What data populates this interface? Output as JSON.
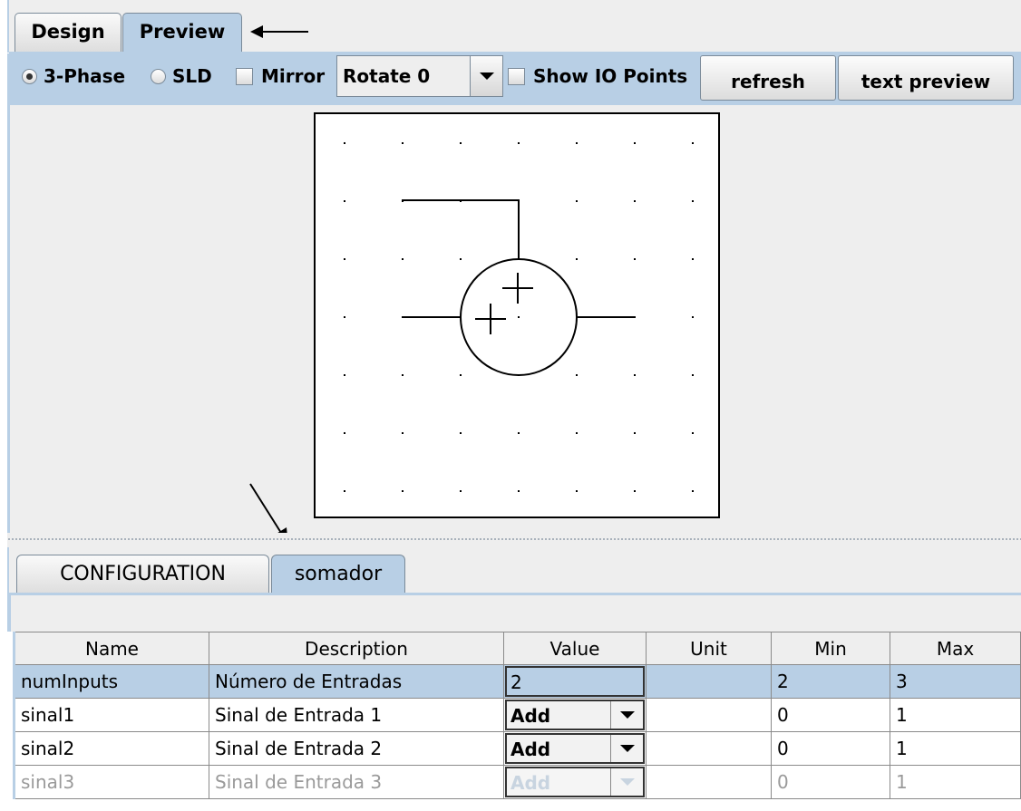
{
  "tabs": {
    "design": "Design",
    "preview": "Preview"
  },
  "toolbar": {
    "three_phase": "3-Phase",
    "sld": "SLD",
    "mirror": "Mirror",
    "rotate_value": "Rotate  0",
    "show_io": "Show IO Points",
    "refresh": "refresh",
    "text_preview": "text preview",
    "selected_mode": "3-Phase"
  },
  "symbol": {
    "grid": "7x7 dotted",
    "sign_top": "+",
    "sign_left": "+"
  },
  "bottom_tabs": {
    "configuration": "CONFIGURATION",
    "somador": "somador"
  },
  "table": {
    "headers": [
      "Name",
      "Description",
      "Value",
      "Unit",
      "Min",
      "Max"
    ],
    "rows": [
      {
        "name": "numInputs",
        "description": "Número de Entradas",
        "value": "2",
        "unit": "",
        "min": "2",
        "max": "3"
      },
      {
        "name": "sinal1",
        "description": "Sinal de Entrada 1",
        "value": "Add",
        "unit": "",
        "min": "0",
        "max": "1"
      },
      {
        "name": "sinal2",
        "description": "Sinal de Entrada 2",
        "value": "Add",
        "unit": "",
        "min": "0",
        "max": "1"
      },
      {
        "name": "sinal3",
        "description": "Sinal de Entrada 3",
        "value": "Add",
        "unit": "",
        "min": "0",
        "max": "1"
      }
    ]
  },
  "colors": {
    "accent": "#b8cfe5",
    "panel": "#eeeeee"
  }
}
